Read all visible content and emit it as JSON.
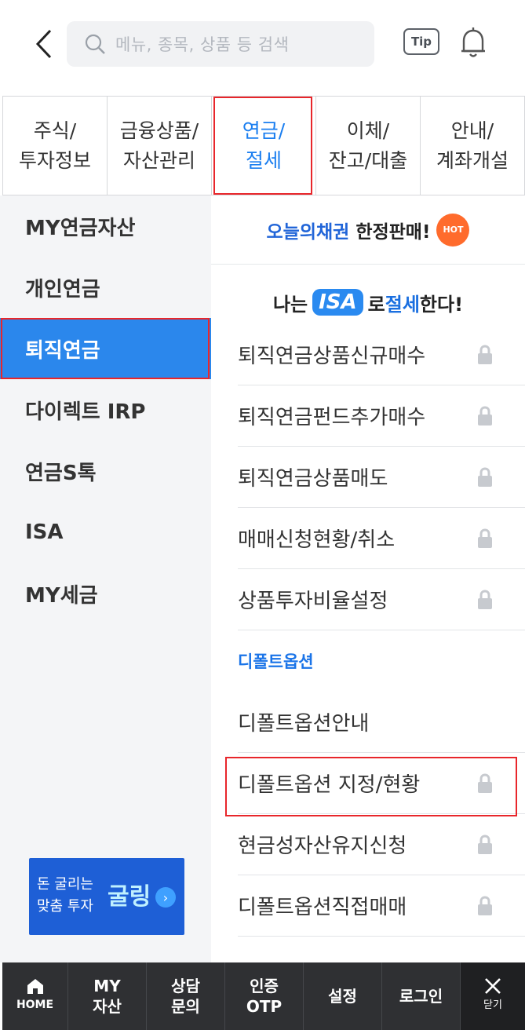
{
  "header": {
    "search_placeholder": "메뉴, 종목, 상품 등 검색",
    "tip_label": "Tip"
  },
  "top_tabs": [
    {
      "label": "주식/\n투자정보"
    },
    {
      "label": "금융상품/\n자산관리"
    },
    {
      "label": "연금/\n절세"
    },
    {
      "label": "이체/\n잔고/대출"
    },
    {
      "label": "안내/\n계좌개설"
    }
  ],
  "sidebar": {
    "items": [
      {
        "label": "MY연금자산"
      },
      {
        "label": "개인연금"
      },
      {
        "label": "퇴직연금"
      },
      {
        "label": "다이렉트 IRP"
      },
      {
        "label": "연금S톡"
      },
      {
        "label": "ISA"
      },
      {
        "label": "MY세금"
      }
    ],
    "promo_text": "돈 굴리는\n맞춤 투자",
    "promo_logo": "굴링"
  },
  "content": {
    "hot_banner_blue": "오늘의채권",
    "hot_banner_dark": "한정판매!",
    "hot_badge": "HOT",
    "isa_prefix": "나는",
    "isa_badge": "ISA",
    "isa_mid": "로",
    "isa_blue": "절세",
    "isa_suffix": "한다!",
    "menu_items": [
      {
        "label": "퇴직연금상품신규매수"
      },
      {
        "label": "퇴직연금펀드추가매수"
      },
      {
        "label": "퇴직연금상품매도"
      },
      {
        "label": "매매신청현황/취소"
      },
      {
        "label": "상품투자비율설정"
      }
    ],
    "section_label": "디폴트옵션",
    "section_items": [
      {
        "label": "디폴트옵션안내"
      },
      {
        "label": "디폴트옵션 지정/현황"
      },
      {
        "label": "현금성자산유지신청"
      },
      {
        "label": "디폴트옵션직접매매"
      }
    ]
  },
  "bottom_bar": {
    "home": "HOME",
    "my_assets": "MY\n자산",
    "consult": "상담\n문의",
    "auth": "인증\nOTP",
    "settings": "설정",
    "login": "로그인",
    "close": "닫기"
  }
}
